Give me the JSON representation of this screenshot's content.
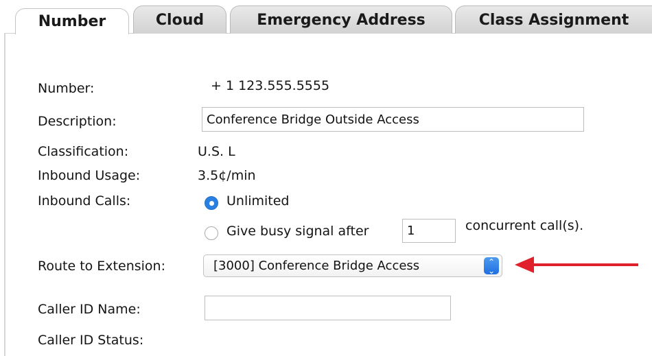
{
  "tabs": [
    {
      "label": "Number",
      "active": true
    },
    {
      "label": "Cloud",
      "active": false
    },
    {
      "label": "Emergency Address",
      "active": false
    },
    {
      "label": "Class Assignment",
      "active": false
    }
  ],
  "form": {
    "number_label": "Number:",
    "number_value": "+ 1 123.555.5555",
    "description_label": "Description:",
    "description_value": "Conference Bridge Outside Access",
    "classification_label": "Classification:",
    "classification_value": "U.S. L",
    "inbound_usage_label": "Inbound Usage:",
    "inbound_usage_value": "3.5¢/min",
    "inbound_calls_label": "Inbound Calls:",
    "inbound_options": {
      "unlimited_label": "Unlimited",
      "unlimited_selected": true,
      "busy_label": "Give busy signal after",
      "busy_selected": false,
      "busy_count": "1",
      "busy_suffix": "concurrent call(s)."
    },
    "route_label": "Route to Extension:",
    "route_value": "[3000] Conference Bridge Access",
    "caller_id_name_label": "Caller ID Name:",
    "caller_id_name_value": "",
    "caller_id_status_label": "Caller ID Status:"
  },
  "colors": {
    "accent": "#2a7fe0",
    "annotation_arrow": "#e0202a"
  },
  "icons": {
    "select_stepper": "chevron-updown-icon",
    "annotation": "arrow-left-icon"
  }
}
